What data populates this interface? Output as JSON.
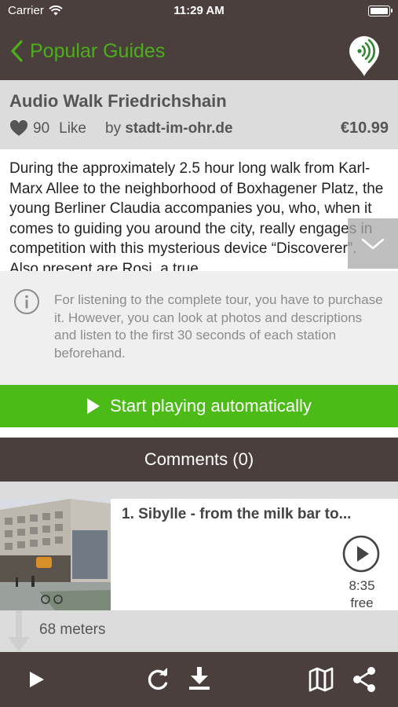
{
  "status_bar": {
    "carrier": "Carrier",
    "time": "11:29 AM"
  },
  "nav": {
    "back_label": "Popular Guides",
    "icons": {
      "back": "chevron-left-icon",
      "logo": "audio-signal-pin-icon"
    }
  },
  "guide": {
    "title": "Audio Walk Friedrichshain",
    "like_count": "90",
    "like_label": "Like",
    "by_prefix": "by",
    "author": "stadt-im-ohr.de",
    "price": "€10.99",
    "description": "During the approximately 2.5 hour long walk from Karl-Marx Allee to the neighborhood of Boxhagener Platz, the young Berliner Claudia accompanies you, who, when it comes to guiding you around the city, really engages in competition with this mysterious device “Discoverer”. Also present are Rosi, a true"
  },
  "info": {
    "text": "For listening to the complete tour, you have to purchase it. However, you can look at photos and descriptions and listen to the first 30 seconds of each station beforehand."
  },
  "actions": {
    "start_playing": "Start playing automatically",
    "comments": "Comments (0)"
  },
  "stations": [
    {
      "title": "1. Sibylle - from the milk bar to...",
      "duration": "8:35",
      "price": "free"
    }
  ],
  "distance_label": "68 meters",
  "toolbar": {
    "icons": [
      "play-icon",
      "refresh-icon",
      "download-icon",
      "map-icon",
      "share-icon"
    ]
  },
  "colors": {
    "bar_brown": "#4a3f3d",
    "accent_green": "#4cbb17",
    "header_grey": "#dcdcdc",
    "info_grey": "#efefef"
  }
}
